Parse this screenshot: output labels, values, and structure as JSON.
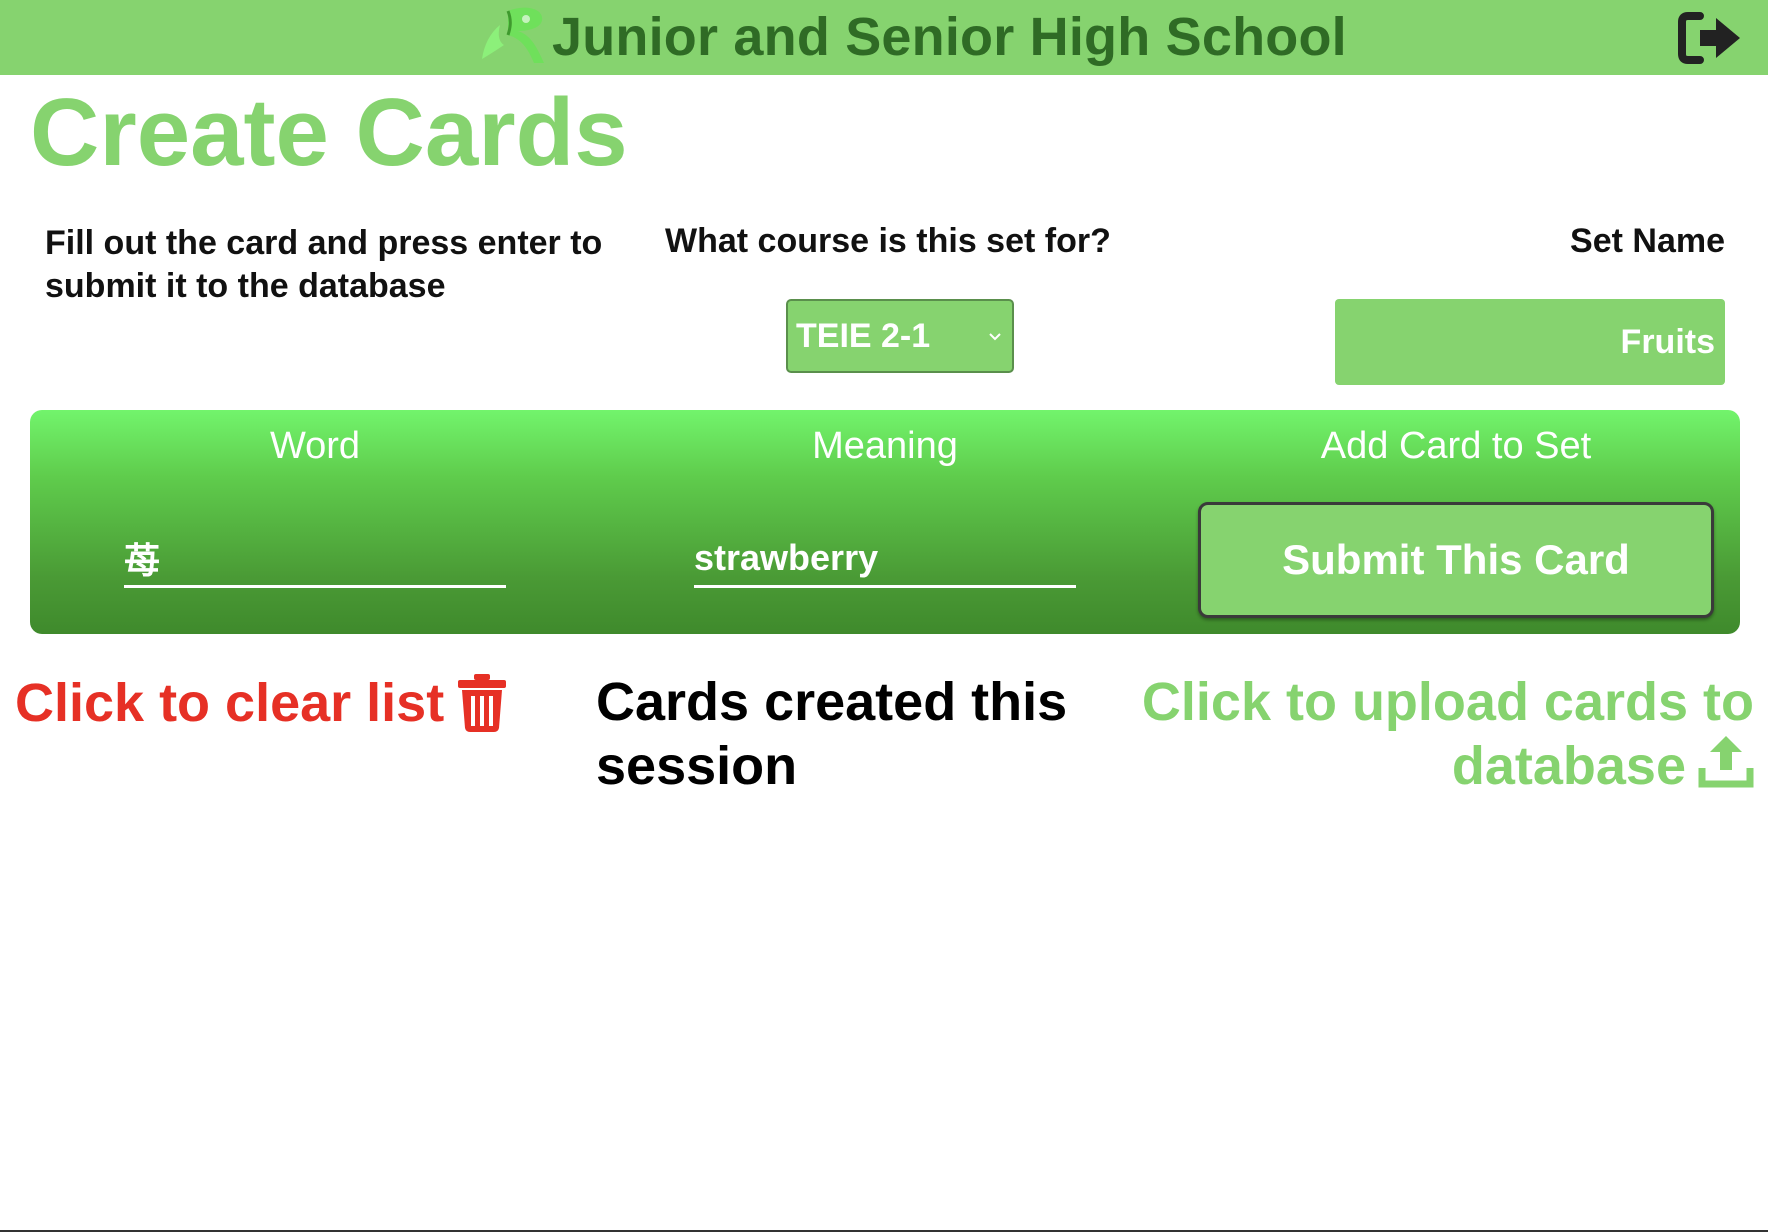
{
  "header": {
    "school_title": "Junior and Senior High School",
    "logo_icon": "school-logo-icon",
    "logout_icon": "sign-out-icon"
  },
  "page": {
    "title": "Create Cards",
    "instructions": "Fill out the card and press enter to submit it to the database"
  },
  "course": {
    "label": "What course is this set for?",
    "selected": "TEIE 2-1"
  },
  "set_name": {
    "label": "Set Name",
    "value": "Fruits"
  },
  "card_form": {
    "word_header": "Word",
    "meaning_header": "Meaning",
    "add_header": "Add Card to Set",
    "word_value": "苺",
    "meaning_value": "strawberry",
    "submit_label": "Submit This Card"
  },
  "actions": {
    "clear_label": "Click to clear list",
    "clear_icon": "trash-icon",
    "session_title": "Cards created this session",
    "upload_label": "Click to upload cards to database",
    "upload_icon": "upload-icon"
  },
  "colors": {
    "brand_green": "#86d36f",
    "dark_green": "#2f6b25",
    "danger_red": "#e63025"
  }
}
